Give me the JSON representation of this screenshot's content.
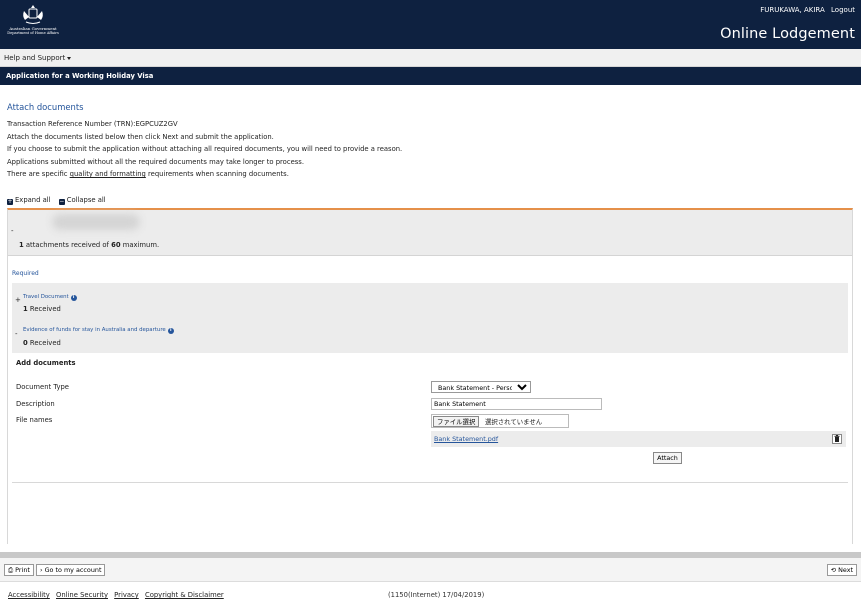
{
  "header": {
    "crest_gov": "Australian Government",
    "crest_dept": "Department of Home Affairs",
    "user_name": "FURUKAWA, AKIRA",
    "logout": "Logout",
    "title": "Online Lodgement"
  },
  "help": {
    "label": "Help and Support"
  },
  "banner": {
    "title": "Application for a Working Holiday Visa"
  },
  "intro": {
    "title": "Attach documents",
    "trn": "Transaction Reference Number (TRN):EGPCUZ2GV",
    "line1": "Attach the documents listed below then click Next and submit the application.",
    "line2": "If you choose to submit the application without attaching all required documents, you will need to provide a reason.",
    "line3": "Applications submitted without all the required documents may take longer to process.",
    "line4_pre": "There are specific ",
    "line4_link": "quality and formatting",
    "line4_post": " requirements when scanning documents."
  },
  "controls": {
    "expand_all": "Expand all",
    "collapse_all": "Collapse all"
  },
  "panel": {
    "dash": "-",
    "attach_count": "1",
    "attach_text_mid": " attachments received of ",
    "attach_max": "60",
    "attach_text_end": " maximum.",
    "required_label": "Required",
    "requirements": [
      {
        "toggle": "+",
        "name": "Travel Document",
        "count": "1",
        "status": "Received"
      },
      {
        "toggle": "-",
        "name": "Evidence of funds for stay in Australia and departure",
        "count": "0",
        "status": "Received"
      }
    ],
    "add_documents": {
      "title": "Add documents",
      "doc_type_label": "Document Type",
      "doc_type_value": "Bank Statement - Personal",
      "description_label": "Description",
      "description_value": "Bank Statement",
      "file_names_label": "File names",
      "file_button": "ファイル選択",
      "file_none": "選択されていません",
      "attached_file": "Bank Statement.pdf",
      "attach_button": "Attach"
    }
  },
  "footer": {
    "print": "Print",
    "go_account": "Go to my account",
    "next": "Next",
    "links": [
      "Accessibility",
      "Online Security",
      "Privacy",
      "Copyright & Disclaimer"
    ],
    "build": "(1150(Internet) 17/04/2019)"
  },
  "colors": {
    "navy": "#0e2140",
    "accent_orange": "#e5904a",
    "link_blue": "#25559b"
  }
}
